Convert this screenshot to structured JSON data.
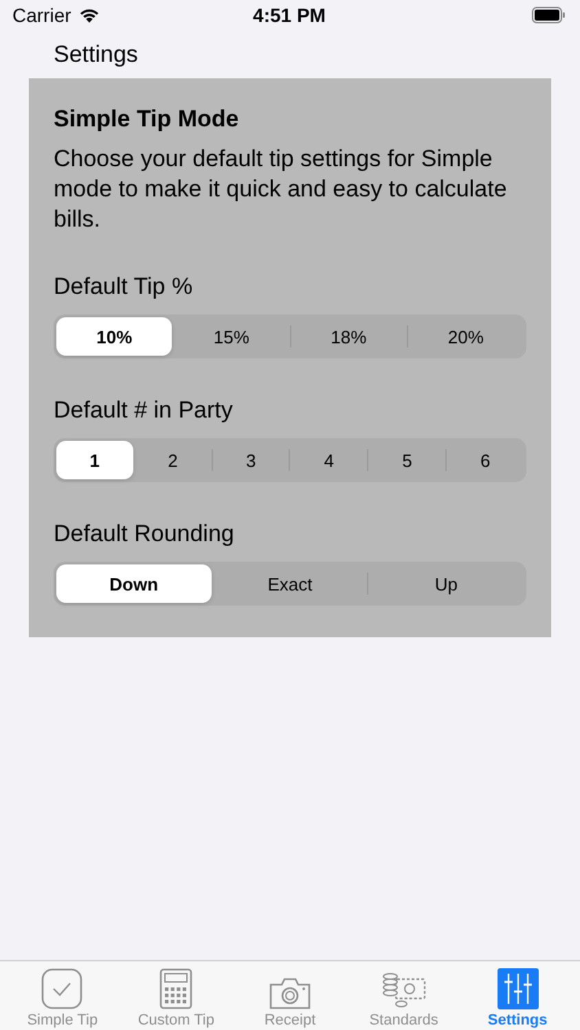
{
  "status_bar": {
    "carrier": "Carrier",
    "time": "4:51 PM"
  },
  "nav_title": "Settings",
  "card": {
    "title": "Simple Tip Mode",
    "description": "Choose your default tip settings for Simple mode to make it quick and easy to calculate bills.",
    "sections": [
      {
        "label": "Default Tip %",
        "options": [
          {
            "label": "10%",
            "selected": true
          },
          {
            "label": "15%",
            "selected": false
          },
          {
            "label": "18%",
            "selected": false
          },
          {
            "label": "20%",
            "selected": false
          }
        ]
      },
      {
        "label": "Default # in Party",
        "options": [
          {
            "label": "1",
            "selected": true
          },
          {
            "label": "2",
            "selected": false
          },
          {
            "label": "3",
            "selected": false
          },
          {
            "label": "4",
            "selected": false
          },
          {
            "label": "5",
            "selected": false
          },
          {
            "label": "6",
            "selected": false
          }
        ]
      },
      {
        "label": "Default Rounding",
        "options": [
          {
            "label": "Down",
            "selected": true
          },
          {
            "label": "Exact",
            "selected": false
          },
          {
            "label": "Up",
            "selected": false
          }
        ]
      }
    ]
  },
  "tab_bar": [
    {
      "label": "Simple Tip",
      "kind": "check",
      "selected": false
    },
    {
      "label": "Custom Tip",
      "kind": "calculator",
      "selected": false
    },
    {
      "label": "Receipt",
      "kind": "camera",
      "selected": false
    },
    {
      "label": "Standards",
      "kind": "money",
      "selected": false
    },
    {
      "label": "Settings",
      "kind": "sliders",
      "selected": true
    }
  ]
}
